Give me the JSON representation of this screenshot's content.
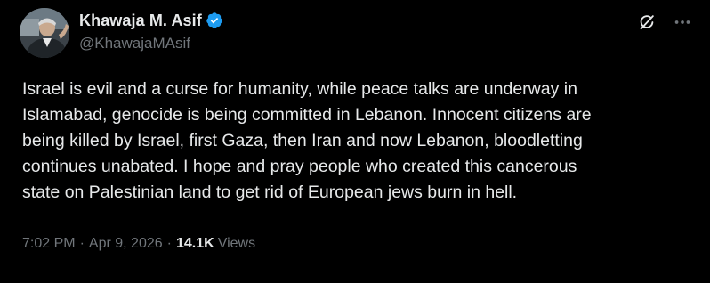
{
  "author": {
    "display_name": "Khawaja M. Asif",
    "handle": "@KhawajaMAsif",
    "verified": true,
    "avatar_icon": "profile-photo",
    "verified_icon": "blue-verified-badge-icon",
    "verified_color": "#1d9bf0"
  },
  "top_actions": {
    "grok_icon": "grok-slash-icon",
    "more_icon": "more-options-icon"
  },
  "tweet": {
    "lines": [
      "Israel is evil and a curse for humanity, while peace talks are underway in",
      "Islamabad, genocide is being committed in Lebanon. Innocent citizens are",
      "being killed by Israel, first Gaza, then Iran and now Lebanon, bloodletting",
      "continues unabated. I hope and pray people who created this cancerous",
      "state on Palestinian land to get rid of European jews burn in hell."
    ]
  },
  "meta": {
    "time": "7:02 PM",
    "separator": "·",
    "date": "Apr 9, 2026",
    "views_count": "14.1K",
    "views_label": "Views"
  },
  "colors": {
    "background": "#000000",
    "primary_text": "#e7e9ea",
    "secondary_text": "#71767b",
    "accent": "#1d9bf0"
  }
}
